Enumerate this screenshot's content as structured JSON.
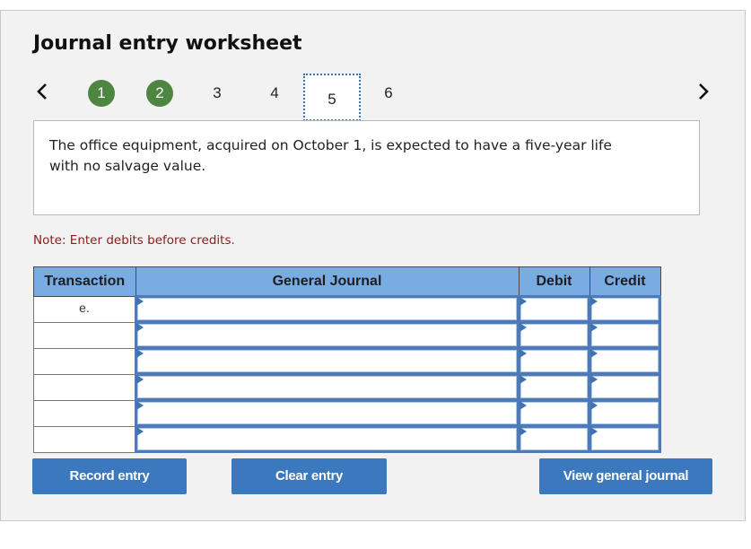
{
  "header": {
    "title": "Journal entry worksheet"
  },
  "navigation": {
    "prev_icon": "chevron-left-icon",
    "next_icon": "chevron-right-icon",
    "steps": [
      {
        "label": "1",
        "state": "completed"
      },
      {
        "label": "2",
        "state": "completed"
      },
      {
        "label": "3",
        "state": "default"
      },
      {
        "label": "4",
        "state": "default"
      },
      {
        "label": "5",
        "state": "current"
      },
      {
        "label": "6",
        "state": "default"
      }
    ]
  },
  "prompt": {
    "text": "The office equipment, acquired on October 1, is expected to have a five-year life with no salvage value."
  },
  "note": "Note: Enter debits before credits.",
  "journal_table": {
    "columns": [
      "Transaction",
      "General Journal",
      "Debit",
      "Credit"
    ],
    "rows": [
      {
        "transaction": "e.",
        "account": "",
        "debit": "",
        "credit": ""
      },
      {
        "transaction": "",
        "account": "",
        "debit": "",
        "credit": ""
      },
      {
        "transaction": "",
        "account": "",
        "debit": "",
        "credit": ""
      },
      {
        "transaction": "",
        "account": "",
        "debit": "",
        "credit": ""
      },
      {
        "transaction": "",
        "account": "",
        "debit": "",
        "credit": ""
      },
      {
        "transaction": "",
        "account": "",
        "debit": "",
        "credit": ""
      }
    ]
  },
  "buttons": {
    "record": "Record entry",
    "clear": "Clear entry",
    "view_journal": "View general journal"
  },
  "colors": {
    "completed_step": "#4e8540",
    "header_bg": "#7aace4",
    "button_bg": "#3b78bd",
    "note_text": "#8b1a1a",
    "input_border": "#4f7ab5"
  }
}
